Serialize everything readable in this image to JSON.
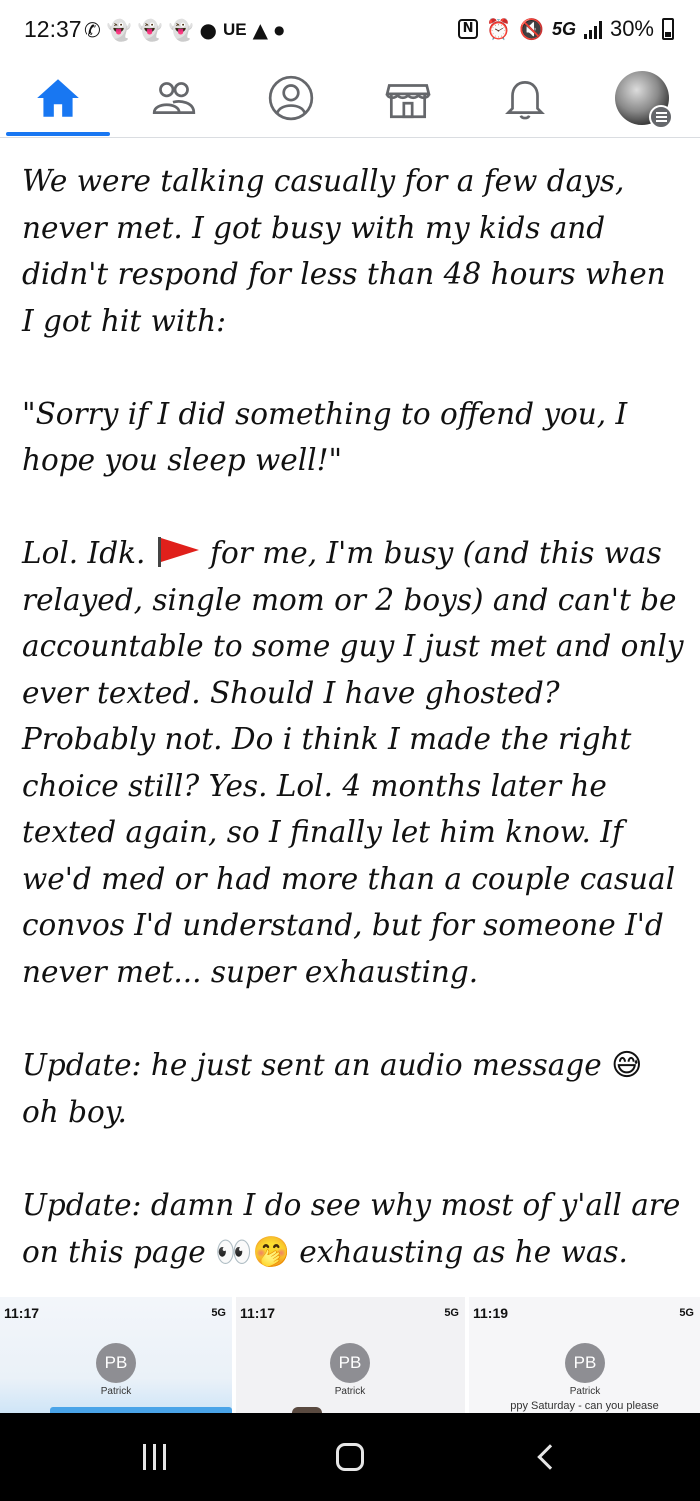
{
  "status_bar": {
    "time": "12:37",
    "carrier_badge": "UE",
    "network": "5G",
    "battery": "30%"
  },
  "nav": {
    "active_tab": "home",
    "accent_color": "#1877f2"
  },
  "post": {
    "paragraphs": [
      "We were talking casually for a few days, never met. I got busy with my kids and didn't respond for less than 48 hours when I got hit with:",
      "\"Sorry if I did something to offend you, I hope you sleep well!\"",
      {
        "before_flag": "Lol. Idk.",
        "flag_icon": "red-flag-icon",
        "after_flag": "for me, I'm busy (and this was relayed, single mom or 2 boys) and can't be accountable to some guy I just met and only ever texted. Should I have ghosted? Probably not. Do i think I made the right choice still? Yes. Lol. 4 months later he texted again, so I finally let him know. If we'd med or had more than a couple casual convos I'd understand, but for someone I'd never met... super exhausting."
      },
      {
        "text": "Update: he just sent an audio message",
        "emoji": "😅",
        "tail": "oh boy."
      },
      {
        "text": "Update: damn I do see why most of y'all are on this page",
        "emoji": "👀🤭",
        "tail": "exhausting as he was."
      }
    ]
  },
  "thumbnails": [
    {
      "time": "11:17",
      "status": "5G",
      "initials": "PB",
      "name": "Patrick",
      "snippet": ""
    },
    {
      "time": "11:17",
      "status": "5G",
      "initials": "PB",
      "name": "Patrick",
      "snippet": ""
    },
    {
      "time": "11:19",
      "status": "5G",
      "initials": "PB",
      "name": "Patrick",
      "snippet": "ppy Saturday - can you please"
    }
  ]
}
